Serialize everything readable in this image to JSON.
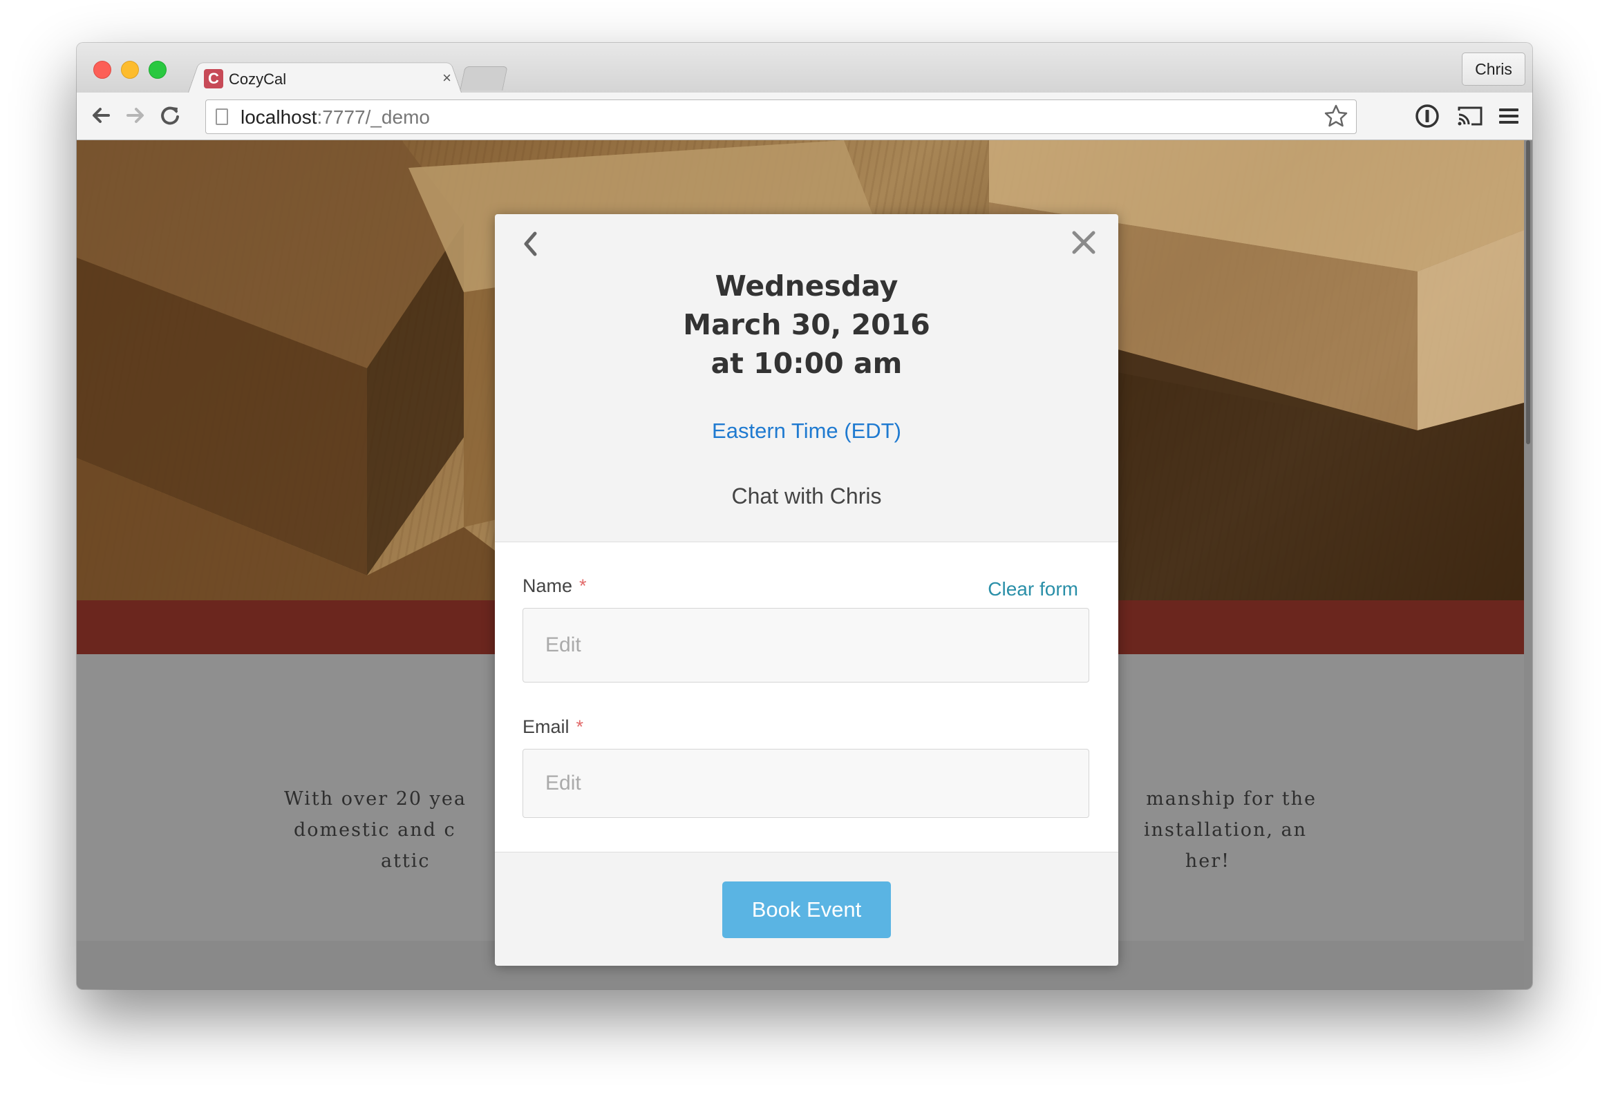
{
  "browser": {
    "tab_title": "CozyCal",
    "favicon_letter": "C",
    "tab_close": "×",
    "profile_name": "Chris",
    "url_host": "localhost",
    "url_rest": ":7777/_demo"
  },
  "icons": {
    "back": "arrow-left-icon",
    "forward": "arrow-right-icon",
    "reload": "reload-icon",
    "bookmark": "star-icon",
    "extension": "password-manager-icon",
    "cast": "cast-icon",
    "menu": "hamburger-menu-icon"
  },
  "page": {
    "about_line_1": "With over 20 yea",
    "about_line_1_end": "manship for the",
    "about_line_2": "domestic and c",
    "about_line_2_end": "installation, an",
    "about_line_3": "attic",
    "about_line_3_end": "her!"
  },
  "modal": {
    "day": "Wednesday",
    "date": "March 30, 2016",
    "time": "at 10:00 am",
    "timezone": "Eastern Time (EDT)",
    "event_name": "Chat with Chris",
    "name_label": "Name",
    "email_label": "Email",
    "required_mark": "*",
    "clear_form": "Clear form",
    "name_placeholder": "Edit",
    "email_placeholder": "Edit",
    "book_button": "Book Event",
    "back_glyph": "‹",
    "close_glyph": "×"
  },
  "colors": {
    "accent_blue": "#1f7ad0",
    "book_button": "#5ab4e3",
    "required_red": "#e26a6a",
    "brand_band": "#6b261e"
  }
}
